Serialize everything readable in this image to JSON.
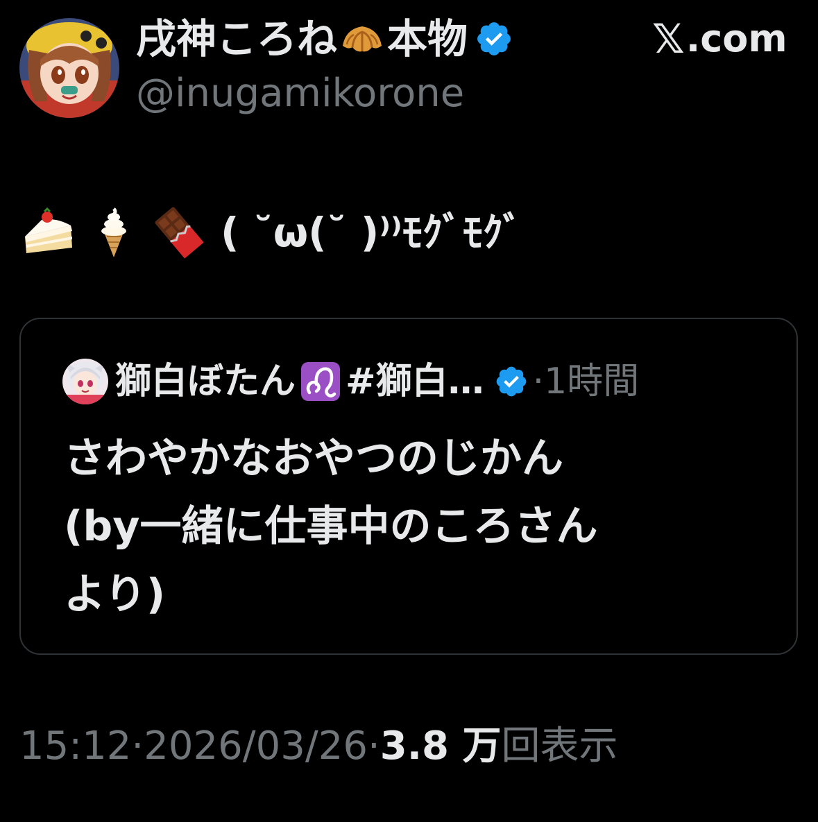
{
  "author": {
    "display_name": "戌神ころね",
    "name_suffix": "本物",
    "name_emoji": "croissant-icon",
    "handle": "@inugamikorone",
    "verified": true
  },
  "brand": {
    "x_glyph": "𝕏",
    "domain": ".com"
  },
  "tweet": {
    "emojis": [
      "cake-icon",
      "soft-ice-cream-icon",
      "chocolate-bar-icon"
    ],
    "text": "( ˘ω(˘ )⁾⁾ﾓｸﾞﾓｸﾞ"
  },
  "quote": {
    "name": "獅白ぼたん",
    "zodiac_emoji": "leo-icon",
    "hashtag": "#獅白…",
    "verified": true,
    "time": "·1時間",
    "body_lines": [
      "さわやかなおやつのじかん",
      "(by一緒に仕事中のころさん",
      "より)"
    ]
  },
  "meta": {
    "time": "15:12",
    "sep1": " · ",
    "date": "2026/03/26",
    "sep2": " · ",
    "views_count": "3.8 万",
    "views_label": "回表示"
  },
  "colors": {
    "background": "#000000",
    "text_primary": "#e7e9ea",
    "text_secondary": "#71767b",
    "verified_blue": "#1d9bf0",
    "card_border": "#2f3336"
  }
}
